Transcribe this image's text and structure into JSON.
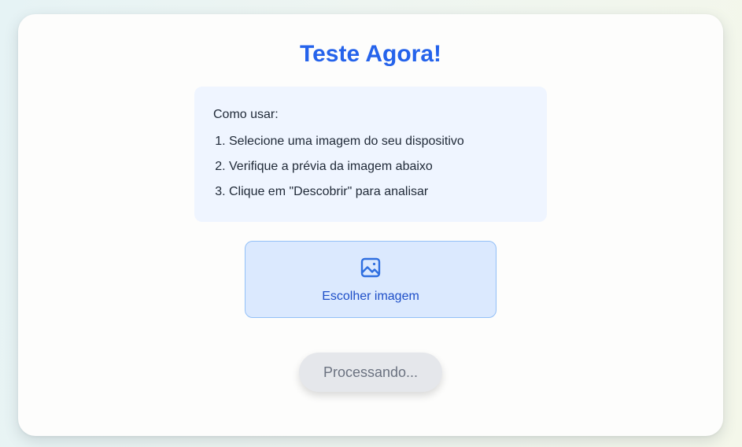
{
  "title": "Teste Agora!",
  "instructions": {
    "heading": "Como usar:",
    "steps": [
      "Selecione uma imagem do seu dispositivo",
      "Verifique a prévia da imagem abaixo",
      "Clique em \"Descobrir\" para analisar"
    ]
  },
  "upload": {
    "icon": "image-icon",
    "label": "Escolher imagem"
  },
  "process_button": {
    "label": "Processando..."
  },
  "colors": {
    "accent": "#2563eb",
    "instructions_bg": "#eff5ff",
    "upload_bg": "#dbe9fe",
    "upload_border": "#93c0f7",
    "disabled_button_bg": "#e5e7eb",
    "disabled_button_text": "#6b7280"
  }
}
